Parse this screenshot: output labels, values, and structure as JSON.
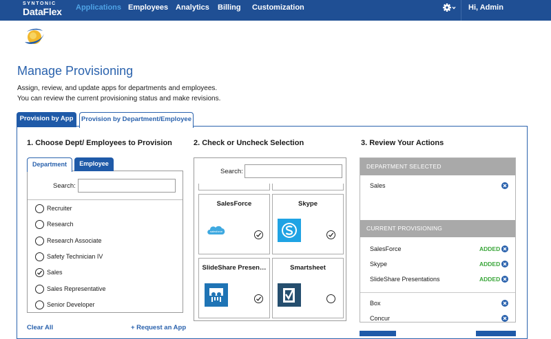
{
  "nav": {
    "brand_top": "SYNTONIC",
    "brand_main": "DataFlex",
    "items": [
      {
        "label": "Applications",
        "active": true
      },
      {
        "label": "Employees",
        "active": false
      },
      {
        "label": "Analytics",
        "active": false
      },
      {
        "label": "Billing",
        "active": false
      },
      {
        "label": "Customization",
        "active": false
      }
    ],
    "settings_icon": "gear-icon",
    "greeting": "Hi, Admin"
  },
  "page": {
    "title": "Manage Provisioning",
    "desc_line1": "Assign, review, and update apps for departments and employees.",
    "desc_line2": "You can review the current provisioning status and make revisions."
  },
  "tabs": {
    "by_app": "Provision by App",
    "by_dept": "Provision by Department/Employee"
  },
  "column1": {
    "title": "1. Choose Dept/ Employees to Provision",
    "tab_department": "Department",
    "tab_employee": "Employee",
    "search_label": "Search:",
    "search_value": "",
    "departments": [
      {
        "label": "Recruiter",
        "selected": false
      },
      {
        "label": "Research",
        "selected": false
      },
      {
        "label": "Research Associate",
        "selected": false
      },
      {
        "label": "Safety Technician IV",
        "selected": false
      },
      {
        "label": "Sales",
        "selected": true
      },
      {
        "label": "Sales Representative",
        "selected": false
      },
      {
        "label": "Senior Developer",
        "selected": false
      }
    ],
    "clear_all": "Clear All",
    "request_app": "+ Request an App"
  },
  "column2": {
    "title": "2. Check or Uncheck Selection",
    "search_label": "Search:",
    "search_value": "",
    "apps": [
      {
        "name": "SalesForce",
        "checked": true,
        "logo_text": "salesforce"
      },
      {
        "name": "Skype",
        "checked": true
      },
      {
        "name": "SlideShare Presen…",
        "checked": true
      },
      {
        "name": "Smartsheet",
        "checked": false
      }
    ]
  },
  "column3": {
    "title": "3. Review Your Actions",
    "dept_selected_header": "DEPARTMENT SELECTED",
    "selected_department": "Sales",
    "current_header": "CURRENT PROVISIONING",
    "added_label": "ADDED",
    "added_items": [
      "SalesForce",
      "Skype",
      "SlideShare Presentations"
    ],
    "other_items": [
      "Box",
      "Concur"
    ]
  },
  "colors": {
    "nav_bg": "#1f4f94",
    "accent": "#2a62ad",
    "active_nav": "#4fa3e6",
    "added_green": "#3aa63a",
    "review_header_gray": "#a9a9a9"
  }
}
